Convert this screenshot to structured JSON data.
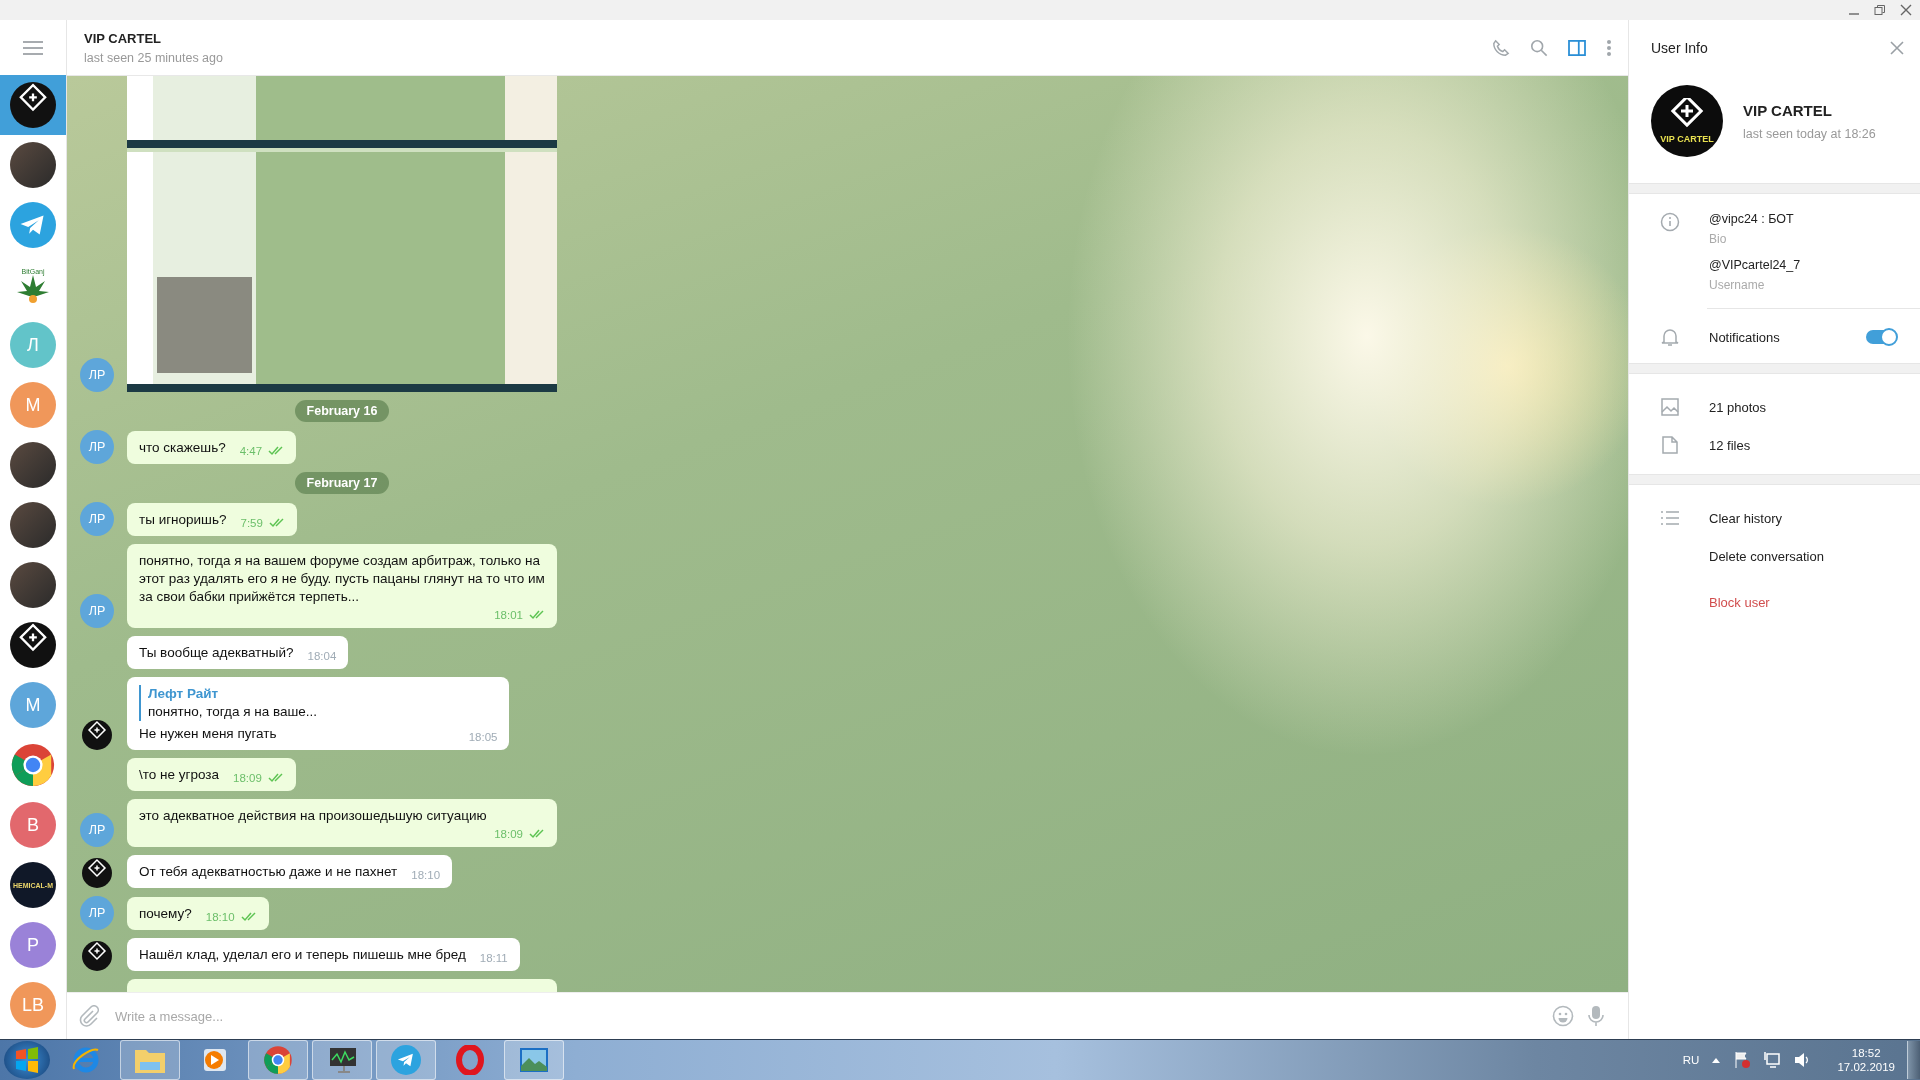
{
  "sidebar": {
    "chats": [
      {
        "kind": "logo",
        "selected": true
      },
      {
        "kind": "photo",
        "selected": false
      },
      {
        "kind": "telegram",
        "selected": false
      },
      {
        "kind": "cannabis",
        "label": "BitGanj",
        "selected": false
      },
      {
        "kind": "letter",
        "label": "Л",
        "color": "#62c4c9",
        "selected": false
      },
      {
        "kind": "letter",
        "label": "M",
        "color": "#f0975a",
        "selected": false
      },
      {
        "kind": "photo",
        "selected": false
      },
      {
        "kind": "photo",
        "selected": false
      },
      {
        "kind": "photo",
        "selected": false
      },
      {
        "kind": "logo",
        "selected": false
      },
      {
        "kind": "letter",
        "label": "M",
        "color": "#5ea6da",
        "selected": false
      },
      {
        "kind": "chrome",
        "selected": false
      },
      {
        "kind": "letter",
        "label": "B",
        "color": "#e2686d",
        "selected": false
      },
      {
        "kind": "text",
        "label": "HEMICAL-M",
        "selected": false
      },
      {
        "kind": "letter",
        "label": "P",
        "color": "#9a82d8",
        "selected": false
      },
      {
        "kind": "letter",
        "label": "LB",
        "color": "#f0975a",
        "selected": false
      }
    ]
  },
  "chat": {
    "title": "VIP CARTEL",
    "status": "last seen 25 minutes ago",
    "info_panel_open": true
  },
  "messages": [
    {
      "kind": "image",
      "avatar": "ЛР"
    },
    {
      "kind": "date",
      "text": "February 16"
    },
    {
      "kind": "out",
      "text": "что скажешь?",
      "time": "4:47",
      "read": true,
      "avatar": "ЛР"
    },
    {
      "kind": "date",
      "text": "February 17"
    },
    {
      "kind": "out",
      "text": "ты игноришь?",
      "time": "7:59",
      "read": true,
      "avatar": "ЛР"
    },
    {
      "kind": "out",
      "text": "понятно, тогда я на вашем форуме создам арбитраж, только на этот раз удалять его я не буду. пусть пацаны глянут на то что им за свои бабки прийжётся терпеть...",
      "time": "18:01",
      "read": true,
      "avatar": "ЛР"
    },
    {
      "kind": "in",
      "text": "Ты вообще адекватный?",
      "time": "18:04",
      "avatar": false
    },
    {
      "kind": "in",
      "reply": {
        "author": "Лефт Райт",
        "text": "понятно, тогда я на ваше..."
      },
      "text": "Не нужен меня пугать",
      "time": "18:05",
      "avatar": true
    },
    {
      "kind": "out",
      "text": "\\то не угроза",
      "time": "18:09",
      "read": true
    },
    {
      "kind": "out",
      "text": "это адекватное действия на произошедьшую ситуацию",
      "time": "18:09",
      "read": true,
      "avatar": "ЛР"
    },
    {
      "kind": "in",
      "text": "От тебя адекватностью даже и не пахнет",
      "time": "18:10",
      "avatar": true
    },
    {
      "kind": "out",
      "text": "почему?",
      "time": "18:10",
      "read": true,
      "avatar": "ЛР"
    },
    {
      "kind": "in",
      "text": "Нашёл клад, уделал его и теперь пишешь мне бред",
      "time": "18:11",
      "avatar": true
    },
    {
      "kind": "cut"
    }
  ],
  "composer": {
    "placeholder": "Write a message..."
  },
  "user_info": {
    "title": "User Info",
    "name": "VIP CARTEL",
    "logo_text": "VIP CARTEL",
    "status": "last seen today at 18:26",
    "fields": [
      {
        "value": "@vipc24 : БОТ",
        "label": "Bio"
      },
      {
        "value": "@VIPcartel24_7",
        "label": "Username"
      }
    ],
    "notifications": {
      "label": "Notifications",
      "on": true
    },
    "media": [
      {
        "kind": "photos",
        "label": "21 photos"
      },
      {
        "kind": "files",
        "label": "12 files"
      }
    ],
    "actions": [
      {
        "label": "Clear history",
        "danger": false
      },
      {
        "label": "Delete conversation",
        "danger": false
      },
      {
        "label": "Block user",
        "danger": true
      }
    ]
  },
  "taskbar": {
    "apps": [
      {
        "kind": "ie",
        "active": false
      },
      {
        "kind": "folder",
        "active": true
      },
      {
        "kind": "media",
        "active": false
      },
      {
        "kind": "chrome",
        "active": true
      },
      {
        "kind": "monitor",
        "active": true
      },
      {
        "kind": "telegram",
        "active": true
      },
      {
        "kind": "opera",
        "active": false
      },
      {
        "kind": "photos",
        "active": true
      }
    ],
    "language": "RU",
    "time": "18:52",
    "date": "17.02.2019"
  }
}
